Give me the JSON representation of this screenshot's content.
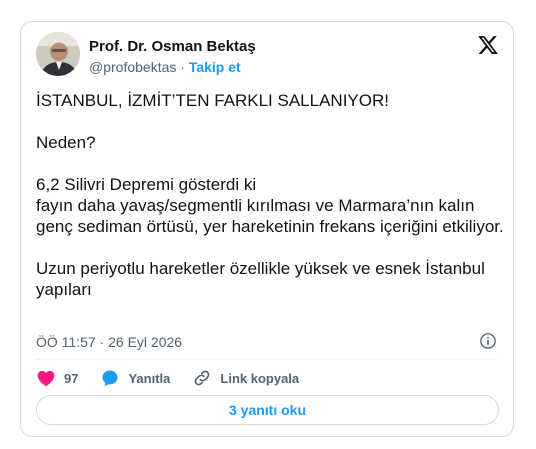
{
  "author": {
    "name": "Prof. Dr. Osman Bektaş",
    "handle": "@profobektas",
    "separator": "·",
    "follow_label": "Takip et"
  },
  "tweet": {
    "paragraphs": [
      "İSTANBUL, İZMİT’TEN FARKLI SALLANIYOR!",
      "Neden?",
      "6,2 Silivri Depremi gösterdi ki\nfayın daha yavaş/segmentli kırılması ve Marmara’nın kalın genç sediman örtüsü, yer hareketinin frekans içeriğini etkiliyor.",
      "Uzun periyotlu hareketler özellikle yüksek ve esnek İstanbul yapıları"
    ],
    "timestamp": "ÖÖ 11:57 · 26 Eyl 2026"
  },
  "actions": {
    "like_count": "97",
    "reply_label": "Yanıtla",
    "copy_link_label": "Link kopyala"
  },
  "read_replies_label": "3 yanıtı oku",
  "colors": {
    "like": "#f91880",
    "reply": "#1d9bf0",
    "link": "#1d9bf0",
    "text": "#0f1419",
    "secondary": "#536471",
    "border": "#cfd9de"
  },
  "icons": [
    "x-logo-icon",
    "info-icon",
    "heart-icon",
    "reply-bubble-icon",
    "link-icon"
  ]
}
